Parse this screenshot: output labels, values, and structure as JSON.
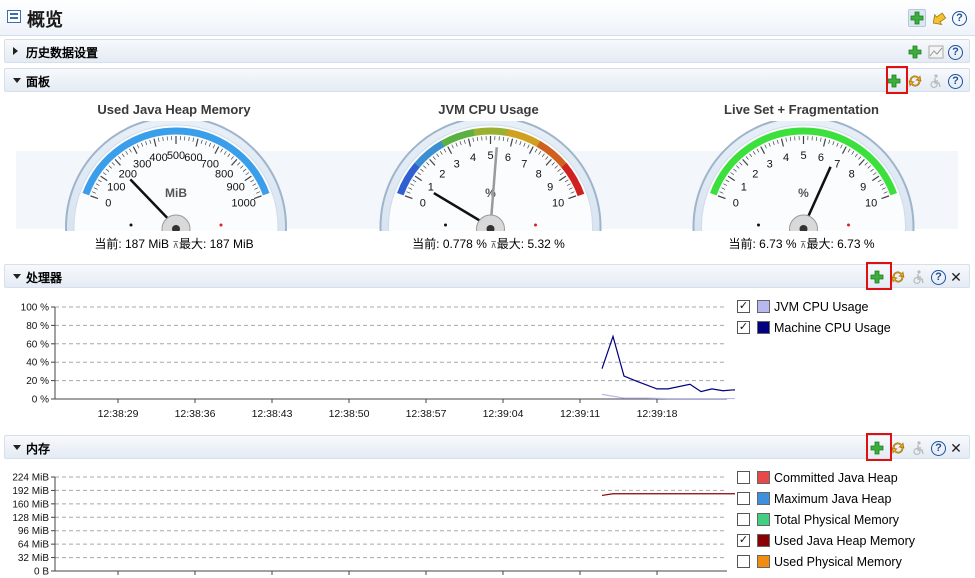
{
  "app": {
    "title": "概览"
  },
  "sections": {
    "history": {
      "title": "历史数据设置"
    },
    "dashboard": {
      "title": "面板"
    },
    "processor": {
      "title": "处理器"
    },
    "memory": {
      "title": "内存"
    }
  },
  "gauges": [
    {
      "title": "Used Java Heap Memory",
      "unit": "MiB",
      "min": 0,
      "max": 1000,
      "ticks": [
        "0",
        "100",
        "200",
        "300",
        "400",
        "500",
        "600",
        "700",
        "800",
        "900",
        "1000"
      ],
      "value": 187,
      "current_label": "当前: 187 MiB ",
      "max_label": "最大: 187 MiB",
      "track_color": "#3b9eea"
    },
    {
      "title": "JVM CPU Usage",
      "unit": "%",
      "min": 0,
      "max": 10,
      "ticks": [
        "0",
        "1",
        "2",
        "3",
        "4",
        "5",
        "6",
        "7",
        "8",
        "9",
        "10"
      ],
      "value": 0.778,
      "max_value": 5.32,
      "current_label": "当前: 0.778 % ",
      "max_label": "最大: 5.32 %",
      "track_color": "gradient"
    },
    {
      "title": "Live Set + Fragmentation",
      "unit": "%",
      "min": 0,
      "max": 10,
      "ticks": [
        "0",
        "1",
        "2",
        "3",
        "4",
        "5",
        "6",
        "7",
        "8",
        "9",
        "10"
      ],
      "value": 6.73,
      "current_label": "当前: 6.73 % ",
      "max_label": "最大: 6.73 %",
      "track_color": "#3ce03c"
    }
  ],
  "chart_data": [
    {
      "type": "line",
      "y_ticks": [
        "0 %",
        "20 %",
        "40 %",
        "60 %",
        "80 %",
        "100 %"
      ],
      "ylim": [
        0,
        100
      ],
      "x_ticks": [
        "12:38:29",
        "12:38:36",
        "12:38:43",
        "12:38:50",
        "12:38:57",
        "12:39:04",
        "12:39:11",
        "12:39:18"
      ],
      "series": [
        {
          "name": "JVM CPU Usage",
          "color": "#b8b8f0",
          "checked": true,
          "x": [
            "12:39:13",
            "12:39:14",
            "12:39:15",
            "12:39:17",
            "12:39:19",
            "12:39:21",
            "12:39:23",
            "12:39:24",
            "12:39:25",
            "12:39:27"
          ],
          "values": [
            5,
            3,
            1,
            1,
            0.5,
            0.5,
            0.5,
            0.5,
            0.5,
            0.5
          ]
        },
        {
          "name": "Machine CPU Usage",
          "color": "#000080",
          "checked": true,
          "x": [
            "12:39:13",
            "12:39:14",
            "12:39:15",
            "12:39:16",
            "12:39:18",
            "12:39:19",
            "12:39:21",
            "12:39:22",
            "12:39:23",
            "12:39:24",
            "12:39:25",
            "12:39:26",
            "12:39:27"
          ],
          "values": [
            33,
            68,
            25,
            20,
            11,
            11,
            16,
            8,
            11,
            9,
            10,
            8,
            7
          ]
        }
      ]
    },
    {
      "type": "line",
      "y_ticks": [
        "0 B",
        "32 MiB",
        "64 MiB",
        "96 MiB",
        "128 MiB",
        "160 MiB",
        "192 MiB",
        "224 MiB"
      ],
      "ylim": [
        0,
        224
      ],
      "series": [
        {
          "name": "Committed Java Heap",
          "color": "#e84848",
          "checked": false
        },
        {
          "name": "Maximum Java Heap",
          "color": "#3f8fe0",
          "checked": false
        },
        {
          "name": "Total Physical Memory",
          "color": "#40d080",
          "checked": false
        },
        {
          "name": "Used Java Heap Memory",
          "color": "#8b0000",
          "checked": true,
          "x": [
            "12:39:13",
            "12:39:14",
            "12:39:27"
          ],
          "values": [
            180,
            184,
            184
          ]
        },
        {
          "name": "Used Physical Memory",
          "color": "#f08c10",
          "checked": false
        }
      ]
    }
  ]
}
